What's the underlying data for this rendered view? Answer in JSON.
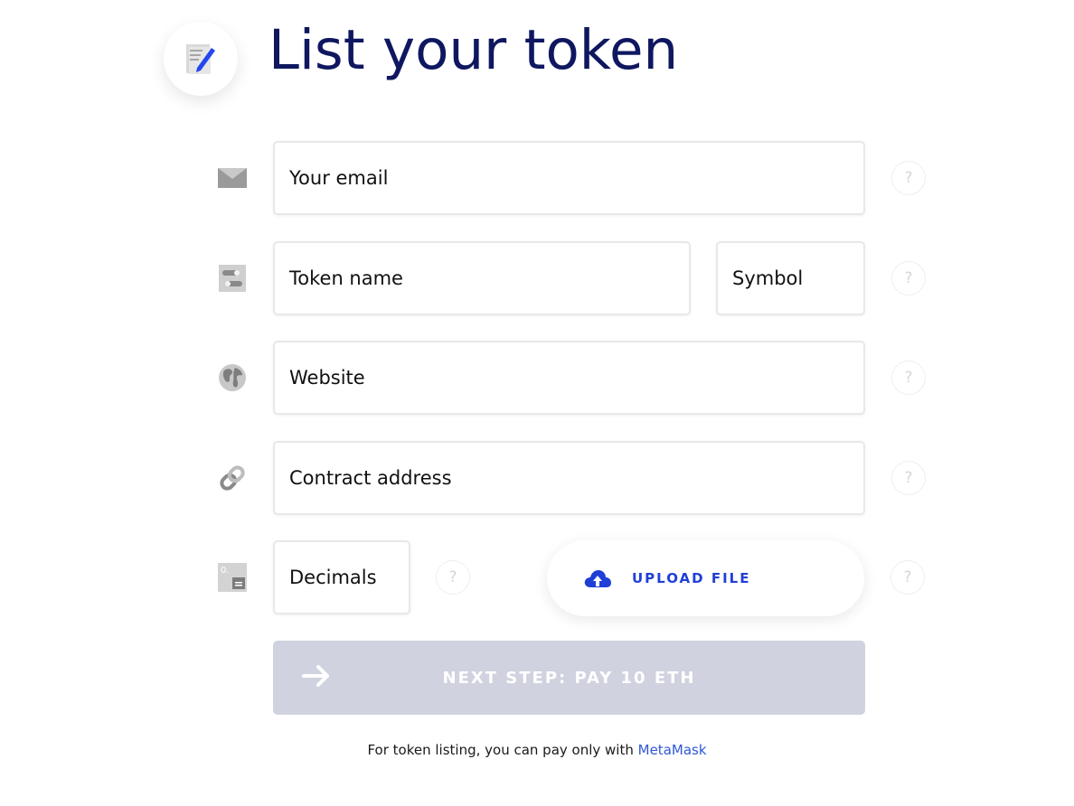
{
  "header": {
    "title": "List your token",
    "logo_icon": "edit-document-icon"
  },
  "form": {
    "email": {
      "placeholder": "Your email",
      "icon": "envelope-icon"
    },
    "token_name": {
      "placeholder": "Token name",
      "icon": "toggle-icon"
    },
    "symbol": {
      "placeholder": "Symbol"
    },
    "website": {
      "placeholder": "Website",
      "icon": "globe-icon"
    },
    "contract": {
      "placeholder": "Contract address",
      "icon": "link-icon"
    },
    "decimals": {
      "placeholder": "Decimals",
      "icon": "decimals-icon"
    },
    "help_label": "?",
    "upload": {
      "label": "UPLOAD FILE",
      "icon": "cloud-upload-icon"
    },
    "next": {
      "label": "NEXT STEP: PAY 10 ETH",
      "icon": "arrow-right-icon"
    }
  },
  "footer": {
    "text": "For token listing, you can pay only with ",
    "link": "MetaMask"
  },
  "colors": {
    "title": "#0f1760",
    "accent": "#1f3fd6",
    "button_disabled": "#d0d2df",
    "link": "#2f57d8"
  }
}
